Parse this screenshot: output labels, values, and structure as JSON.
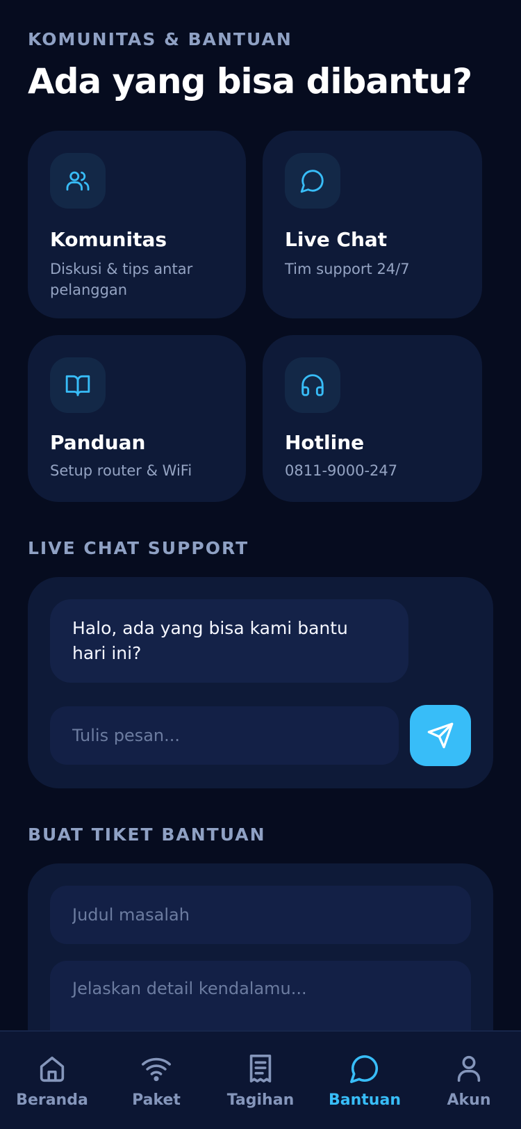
{
  "header": {
    "eyebrow": "KOMUNITAS & BANTUAN",
    "title": "Ada yang bisa dibantu?"
  },
  "cards": [
    {
      "icon": "users-icon",
      "title": "Komunitas",
      "subtitle": "Diskusi & tips antar pelanggan"
    },
    {
      "icon": "chat-bubble-icon",
      "title": "Live Chat",
      "subtitle": "Tim support 24/7"
    },
    {
      "icon": "book-open-icon",
      "title": "Panduan",
      "subtitle": "Setup router & WiFi"
    },
    {
      "icon": "headphones-icon",
      "title": "Hotline",
      "subtitle": "0811-9000-247"
    }
  ],
  "chat": {
    "section_label": "LIVE CHAT SUPPORT",
    "message": "Halo, ada yang bisa kami bantu hari ini?",
    "input_placeholder": "Tulis pesan...",
    "send_icon": "send-icon"
  },
  "ticket": {
    "section_label": "BUAT TIKET BANTUAN",
    "title_placeholder": "Judul masalah",
    "detail_placeholder": "Jelaskan detail kendalamu..."
  },
  "tabbar": {
    "active": "Bantuan",
    "items": [
      {
        "icon": "home-icon",
        "label": "Beranda"
      },
      {
        "icon": "wifi-icon",
        "label": "Paket"
      },
      {
        "icon": "receipt-icon",
        "label": "Tagihan"
      },
      {
        "icon": "chat-bubble-icon",
        "label": "Bantuan"
      },
      {
        "icon": "user-icon",
        "label": "Akun"
      }
    ]
  },
  "colors": {
    "background": "#060c1f",
    "card": "#0e1a38",
    "accent": "#38bdf8",
    "muted_text": "#8fa1c4"
  }
}
